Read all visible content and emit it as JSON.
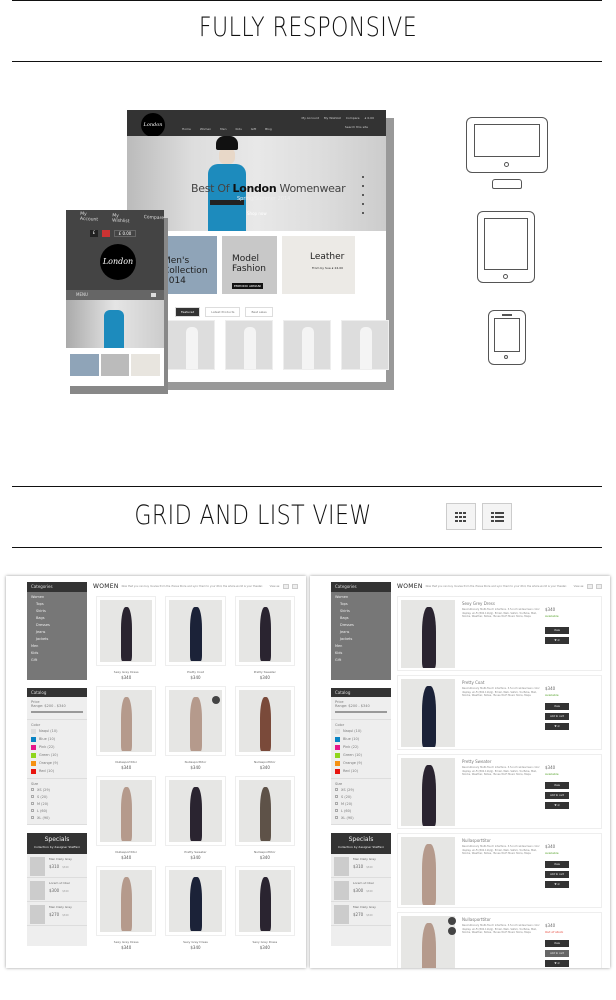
{
  "sections": {
    "responsive_title": "FULLY RESPONSIVE",
    "grid_list_title": "GRID AND LIST VIEW"
  },
  "desktop_mock": {
    "logo": "London",
    "nav": [
      "Home",
      "Women",
      "Men",
      "Kids",
      "Gift",
      "Blog"
    ],
    "top_links": [
      "My Account",
      "My Wishlist",
      "Compare",
      "£ 0.00"
    ],
    "search_placeholder": "Search this site",
    "hero_title_pre": "Best Of ",
    "hero_title_bold": "London",
    "hero_title_post": " Womenwear",
    "hero_subtitle": "Spring/Summer 2014",
    "hero_cta": "Shop now",
    "banners": [
      "Men's Collection 2014",
      "Model Fashion",
      "Leather"
    ],
    "banner_sub": "From by Sue £ 24.00",
    "banner_brand": "EMPORIO ARMANI",
    "tabs": [
      "Featured",
      "Latest Products",
      "Best sales"
    ]
  },
  "phone_mock": {
    "links": [
      "My Account",
      "My Wishlist",
      "Compare"
    ],
    "currency": "£",
    "cart": "£ 0.00",
    "logo": "London",
    "menu": "MENU"
  },
  "devices": [
    "desktop-icon",
    "tablet-icon",
    "phone-icon"
  ],
  "view_buttons": [
    {
      "name": "grid-view-icon"
    },
    {
      "name": "list-view-icon"
    }
  ],
  "shop": {
    "category_heading": "WOMEN",
    "category_desc": "Now that you can buy movies from the iTunes Store and sync them to your iPod, the whole world is your theater.",
    "view_as": "View as:",
    "sidebar": {
      "categories_title": "Categories",
      "categories": [
        {
          "label": "Women",
          "sub": false
        },
        {
          "label": "Tops",
          "sub": true
        },
        {
          "label": "Skirts",
          "sub": true
        },
        {
          "label": "Bags",
          "sub": true
        },
        {
          "label": "Dresses",
          "sub": true
        },
        {
          "label": "Jeans",
          "sub": true
        },
        {
          "label": "Jackets",
          "sub": true
        },
        {
          "label": "Men",
          "sub": false
        },
        {
          "label": "Kids",
          "sub": false
        },
        {
          "label": "Gift",
          "sub": false
        }
      ],
      "catalog_title": "Catalog",
      "price_label": "Price",
      "price_range": "Range: $200 - $340",
      "color_label": "Color",
      "colors": [
        {
          "label": "Naqul (10)",
          "hex": "#dddddd"
        },
        {
          "label": "Blue (10)",
          "hex": "#0a84c4"
        },
        {
          "label": "Pink (22)",
          "hex": "#e6178a"
        },
        {
          "label": "Green (10)",
          "hex": "#8fd61c"
        },
        {
          "label": "Orange (9)",
          "hex": "#f59112"
        },
        {
          "label": "Red (10)",
          "hex": "#e8150f"
        }
      ],
      "size_label": "Size",
      "sizes": [
        "XS (29)",
        "S (20)",
        "M (20)",
        "L (60)",
        "XL (90)"
      ],
      "specials_title": "Specials",
      "specials_sub": "Collection by designer Steffani",
      "specials": [
        {
          "name": "Men Daily Grey",
          "price": "$310",
          "old": "$340"
        },
        {
          "name": "Lorem ut liber",
          "price": "$300",
          "old": "$340"
        },
        {
          "name": "Men Daily Grey",
          "price": "$270",
          "old": "$340"
        }
      ]
    },
    "grid_products": [
      {
        "name": "Sexy Grey Dress",
        "price": "$340",
        "color": "#2a2430",
        "badge": false
      },
      {
        "name": "Pretty Coat",
        "price": "$340",
        "color": "#1b2238",
        "badge": false
      },
      {
        "name": "Pretty Sweater",
        "price": "$340",
        "color": "#2a2430",
        "badge": false
      },
      {
        "name": "Nullasporttitor",
        "price": "$340",
        "color": "#b59a8c",
        "badge": false
      },
      {
        "name": "Nullasporttitor",
        "price": "$340",
        "color": "#b59a8c",
        "badge": true
      },
      {
        "name": "Nullasporttitor",
        "price": "$340",
        "color": "#7a4a3a",
        "badge": false
      },
      {
        "name": "Nullasporttitor",
        "price": "$340",
        "color": "#b59a8c",
        "badge": false
      },
      {
        "name": "Pretty Sweater",
        "price": "$340",
        "color": "#2a2430",
        "badge": false
      },
      {
        "name": "Nullasporttitor",
        "price": "$340",
        "color": "#5e5248",
        "badge": false
      },
      {
        "name": "Sexy Grey Dress",
        "price": "$340",
        "color": "#b59a8c",
        "badge": false
      },
      {
        "name": "Sexy Grey Dress",
        "price": "$340",
        "color": "#1b2238",
        "badge": false
      },
      {
        "name": "Sexy Grey Dress",
        "price": "$340",
        "color": "#2a2430",
        "badge": false
      }
    ],
    "list_products": [
      {
        "name": "Sexy Grey Dress",
        "price": "$340",
        "status": "Available",
        "status_color": "#5aa531",
        "color": "#2a2430",
        "buttons": [
          "View",
          "wishlist"
        ]
      },
      {
        "name": "Pretty Coat",
        "price": "$340",
        "status": "Available",
        "status_color": "#5aa531",
        "color": "#1b2238",
        "buttons": [
          "View",
          "Add to cart",
          "wishlist"
        ]
      },
      {
        "name": "Pretty Sweater",
        "price": "$340",
        "status": "Available",
        "status_color": "#5aa531",
        "color": "#2a2430",
        "buttons": [
          "View",
          "Add to cart",
          "wishlist"
        ]
      },
      {
        "name": "Nullasporttitor",
        "price": "$340",
        "status": "Available",
        "status_color": "#5aa531",
        "color": "#b59a8c",
        "buttons": [
          "View",
          "Add to cart",
          "wishlist"
        ]
      },
      {
        "name": "Nullasporttitor",
        "price": "$340",
        "status": "Out of stock",
        "status_color": "#e33b2e",
        "color": "#b59a8c",
        "buttons": [
          "View",
          "Add to cart",
          "wishlist"
        ]
      }
    ],
    "list_desc": "Revolutionary Multi-Touch interface. 3.5-inch widescreen color display. wi-Fi (802.11b/g). Email, Web. Safari, YouTube, Mail, Stocks, Weather, Notes, iTunes Wi-Fi Music Store, Maps"
  }
}
